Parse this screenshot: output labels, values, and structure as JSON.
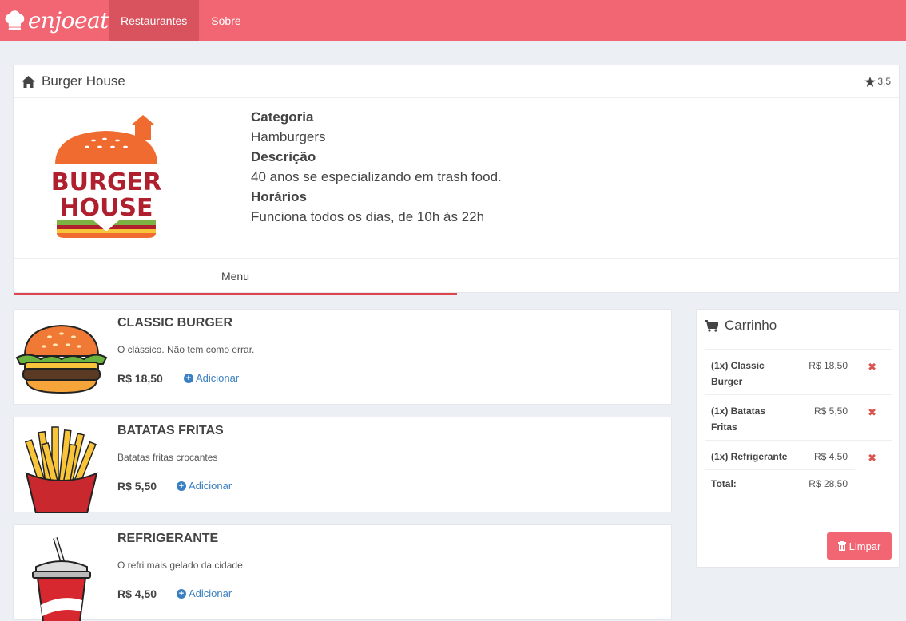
{
  "nav": {
    "brand": "enjoeat",
    "items": [
      {
        "label": "Restaurantes",
        "active": true
      },
      {
        "label": "Sobre",
        "active": false
      }
    ],
    "color": "#f26572"
  },
  "restaurant": {
    "name": "Burger House",
    "rating": "3.5",
    "logo_lines": [
      "BURGER",
      "HOUSE"
    ],
    "category_label": "Categoria",
    "category": "Hamburgers",
    "description_label": "Descrição",
    "description": "40 anos se especializando em trash food.",
    "hours_label": "Horários",
    "hours": "Funciona todos os dias, de 10h às 22h",
    "tabs": [
      {
        "label": "Menu",
        "active": true
      }
    ]
  },
  "menu": [
    {
      "name": "CLASSIC BURGER",
      "description": "O clássico. Não tem como errar.",
      "price": "R$ 18,50",
      "add_label": "Adicionar",
      "icon": "burger-image"
    },
    {
      "name": "BATATAS FRITAS",
      "description": "Batatas fritas crocantes",
      "price": "R$ 5,50",
      "add_label": "Adicionar",
      "icon": "fries-image"
    },
    {
      "name": "REFRIGERANTE",
      "description": "O refri mais gelado da cidade.",
      "price": "R$ 4,50",
      "add_label": "Adicionar",
      "icon": "soda-image"
    }
  ],
  "cart": {
    "title": "Carrinho",
    "items": [
      {
        "name": "(1x) Classic Burger",
        "price": "R$ 18,50"
      },
      {
        "name": "(1x) Batatas Fritas",
        "price": "R$ 5,50"
      },
      {
        "name": "(1x) Refrigerante",
        "price": "R$ 4,50"
      }
    ],
    "total_label": "Total:",
    "total": "R$ 28,50",
    "clear_label": "Limpar",
    "remove_symbol": "✖"
  }
}
